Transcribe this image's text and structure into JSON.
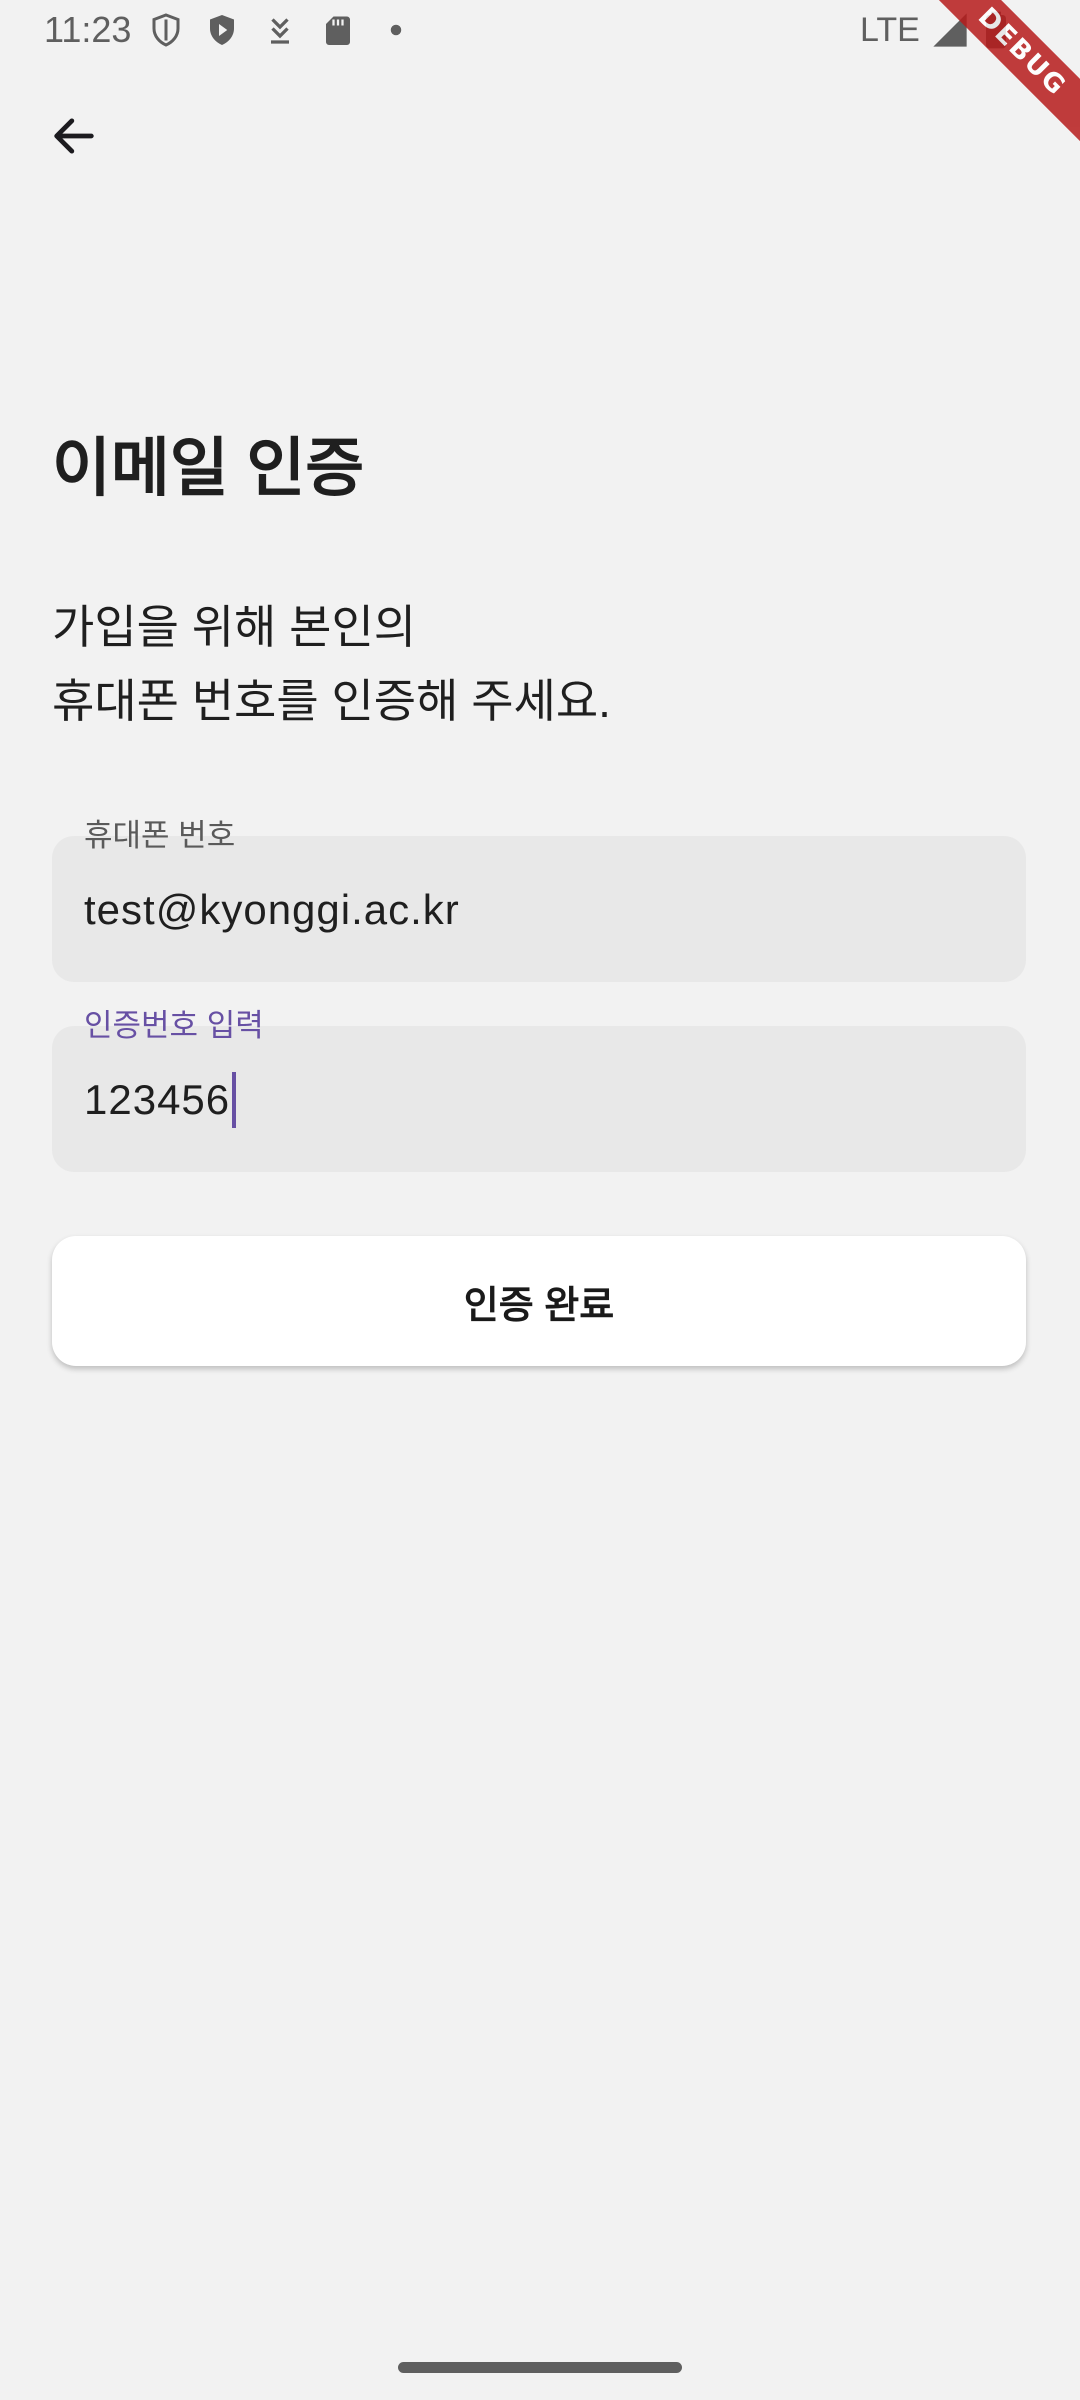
{
  "status_bar": {
    "time": "11:23",
    "network": "LTE",
    "icons": [
      "shield-outline-icon",
      "play-protect-icon",
      "download-icon",
      "sd-card-icon",
      "dot-icon",
      "signal-icon",
      "battery-icon"
    ]
  },
  "debug_banner": "DEBUG",
  "app_bar": {
    "back_icon": "arrow-back-icon"
  },
  "page": {
    "title": "이메일 인증",
    "subtitle_line1": "가입을 위해 본인의",
    "subtitle_line2": "휴대폰 번호를 인증해 주세요."
  },
  "form": {
    "phone_label": "휴대폰 번호",
    "phone_value": "test@kyonggi.ac.kr",
    "code_label": "인증번호 입력",
    "code_value": "123456",
    "submit_label": "인증 완료"
  },
  "colors": {
    "background": "#f2f2f2",
    "field_fill": "#e8e8e8",
    "accent": "#6750a4",
    "debug_banner": "#b71c1c"
  }
}
